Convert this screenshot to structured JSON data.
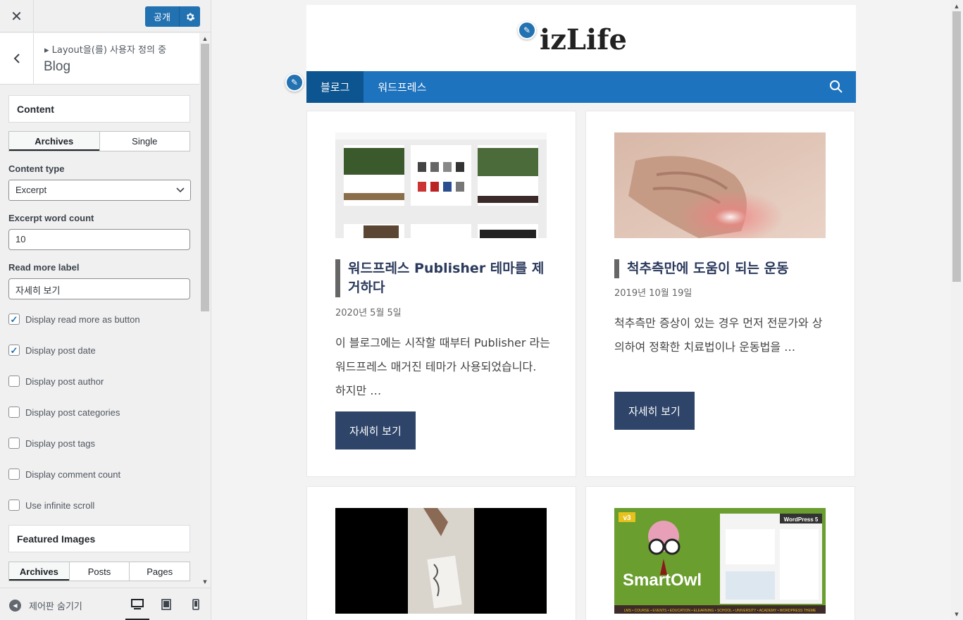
{
  "topbar": {
    "close_label": "✕",
    "publish_label": "공개",
    "settings_icon": "gear-icon"
  },
  "section": {
    "breadcrumb": "▸ Layout을(를) 사용자 정의 중",
    "title": "Blog"
  },
  "content_panel": {
    "title": "Content",
    "tabs": [
      "Archives",
      "Single"
    ],
    "active_tab": "Archives",
    "content_type_label": "Content type",
    "content_type_value": "Excerpt",
    "excerpt_count_label": "Excerpt word count",
    "excerpt_count_value": "10",
    "read_more_label": "Read more label",
    "read_more_value": "자세히 보기",
    "checkboxes": [
      {
        "label": "Display read more as button",
        "checked": true
      },
      {
        "label": "Display post date",
        "checked": true
      },
      {
        "label": "Display post author",
        "checked": false
      },
      {
        "label": "Display post categories",
        "checked": false
      },
      {
        "label": "Display post tags",
        "checked": false
      },
      {
        "label": "Display comment count",
        "checked": false
      },
      {
        "label": "Use infinite scroll",
        "checked": false
      }
    ]
  },
  "featured_panel": {
    "title": "Featured Images",
    "tabs": [
      "Archives",
      "Posts",
      "Pages"
    ],
    "active_tab": "Archives"
  },
  "footer": {
    "hide_label": "제어판 숨기기",
    "devices": [
      "desktop-icon",
      "tablet-icon",
      "mobile-icon"
    ]
  },
  "site": {
    "logo": "izLife",
    "nav": [
      "블로그",
      "워드프레스"
    ],
    "nav_current": "블로그",
    "accent": "#1e73be",
    "button_color": "#2e4469"
  },
  "posts": [
    {
      "title": "워드프레스 Publisher 테마를 제거하다",
      "date": "2020년 5월 5일",
      "excerpt": "이 블로그에는 시작할 때부터 Publisher 라는 워드프레스 매거진 테마가 사용되었습니다. 하지만 …",
      "button": "자세히 보기"
    },
    {
      "title": "척추측만에 도움이 되는 운동",
      "date": "2019년 10월 19일",
      "excerpt": "척추측만 증상이 있는 경우 먼저 전문가와 상의하여 정확한 치료법이나 운동법을 …",
      "button": "자세히 보기"
    }
  ],
  "thumb_texts": {
    "smartowl_version": "v3",
    "smartowl_name": "SmartOwl",
    "smartowl_wp": "WordPress 5",
    "smartowl_footer": "LMS • COURSE • EVENTS • EDUCATION • ELEARNING • SCHOOL • UNIVERSITY • ACADEMY • WORDPRESS THEME"
  }
}
